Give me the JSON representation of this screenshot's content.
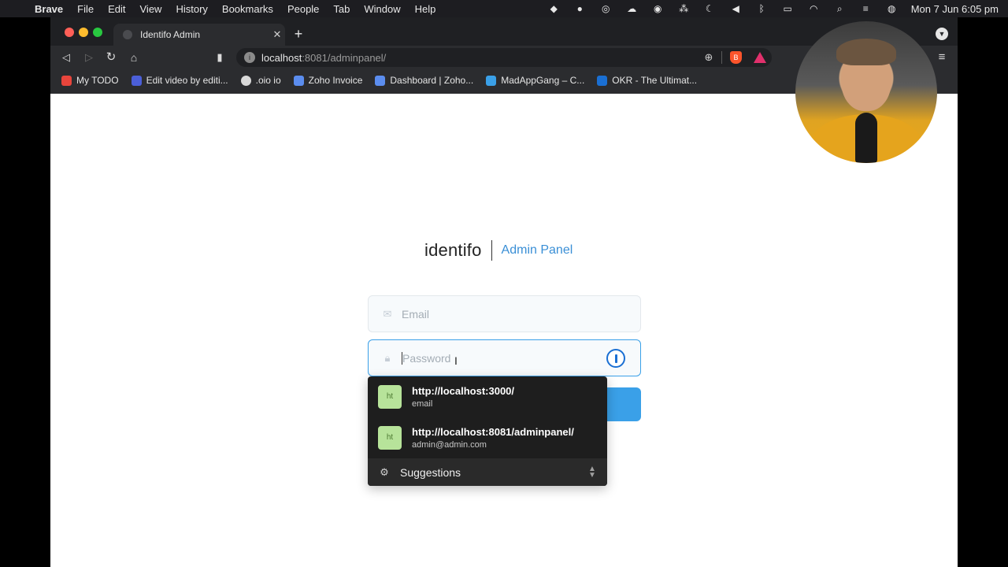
{
  "menubar": {
    "app": "Brave",
    "items": [
      "File",
      "Edit",
      "View",
      "History",
      "Bookmarks",
      "People",
      "Tab",
      "Window",
      "Help"
    ],
    "clock": "Mon 7 Jun  6:05 pm"
  },
  "browser": {
    "tab_title": "Identifo Admin",
    "url_host": "localhost",
    "url_path": ":8081/adminpanel/",
    "bookmarks": [
      {
        "label": "My TODO",
        "color": "#e8453c"
      },
      {
        "label": "Edit video by editi...",
        "color": "#4b5fd8"
      },
      {
        "label": ".oio io",
        "color": "#d9d9d9"
      },
      {
        "label": "Zoho Invoice",
        "color": "#5b8def"
      },
      {
        "label": "Dashboard | Zoho...",
        "color": "#5b8def"
      },
      {
        "label": "MadAppGang – C...",
        "color": "#3aa0e8"
      },
      {
        "label": "OKR - The Ultimat...",
        "color": "#1a6fd3"
      }
    ]
  },
  "page": {
    "brand_name": "identifo",
    "brand_subtitle": "Admin Panel",
    "email_placeholder": "Email",
    "password_placeholder": "Password",
    "accent_color": "#3aa0e8"
  },
  "autofill": {
    "suggestions": [
      {
        "badge": "ht",
        "url": "http://localhost:3000/",
        "username": "email"
      },
      {
        "badge": "ht",
        "url": "http://localhost:8081/adminpanel/",
        "username": "admin@admin.com"
      }
    ],
    "footer_label": "Suggestions"
  }
}
